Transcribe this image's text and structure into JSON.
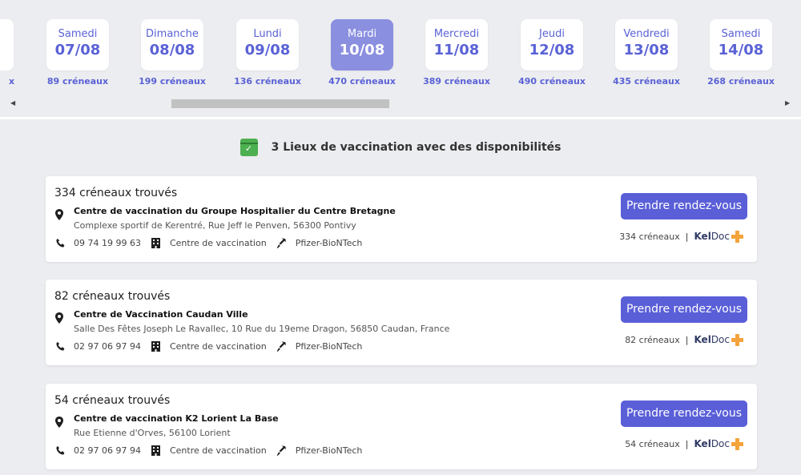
{
  "days": [
    {
      "name": "Samedi",
      "date": "07/08",
      "slots": "89 créneaux",
      "selected": false
    },
    {
      "name": "Dimanche",
      "date": "08/08",
      "slots": "199 créneaux",
      "selected": false
    },
    {
      "name": "Lundi",
      "date": "09/08",
      "slots": "136 créneaux",
      "selected": false
    },
    {
      "name": "Mardi",
      "date": "10/08",
      "slots": "470 créneaux",
      "selected": true
    },
    {
      "name": "Mercredi",
      "date": "11/08",
      "slots": "389 créneaux",
      "selected": false
    },
    {
      "name": "Jeudi",
      "date": "12/08",
      "slots": "490 créneaux",
      "selected": false
    },
    {
      "name": "Vendredi",
      "date": "13/08",
      "slots": "435 créneaux",
      "selected": false
    },
    {
      "name": "Samedi",
      "date": "14/08",
      "slots": "268 créneaux",
      "selected": false
    }
  ],
  "partial_day_slots": "x",
  "heading": "3 Lieux de vaccination avec des disponibilités",
  "centers": [
    {
      "title": "334 créneaux trouvés",
      "name": "Centre de vaccination du Groupe Hospitalier du Centre Bretagne",
      "address": "Complexe sportif de Kerentré, Rue Jeff le Penven, 56300 Pontivy",
      "phone": "09 74 19 99 63",
      "type": "Centre de vaccination",
      "vaccine": "Pfizer-BioNTech",
      "button": "Prendre rendez-vous",
      "slots": "334 créneaux"
    },
    {
      "title": "82 créneaux trouvés",
      "name": "Centre de Vaccination Caudan Ville",
      "address": "Salle Des Fêtes Joseph Le Ravallec, 10 Rue du 19eme Dragon, 56850 Caudan, France",
      "phone": "02 97 06 97 94",
      "type": "Centre de vaccination",
      "vaccine": "Pfizer-BioNTech",
      "button": "Prendre rendez-vous",
      "slots": "82 créneaux"
    },
    {
      "title": "54 créneaux trouvés",
      "name": "Centre de vaccination K2 Lorient La Base",
      "address": "Rue Etienne d'Orves, 56100 Lorient",
      "phone": "02 97 06 97 94",
      "type": "Centre de vaccination",
      "vaccine": "Pfizer-BioNTech",
      "button": "Prendre rendez-vous",
      "slots": "54 créneaux"
    }
  ],
  "platform": {
    "kel": "Kel",
    "doc": "Doc",
    "separator": "|"
  },
  "colors": {
    "accent": "#5a5fd8",
    "selected_day": "#8a8fe0",
    "kel_orange": "#f5a33b",
    "calendar_green": "#4caf50"
  },
  "icons": [
    "calendar-check-icon",
    "map-pin-icon",
    "phone-icon",
    "building-icon",
    "syringe-icon",
    "kel-plus-icon",
    "chevron-left-icon",
    "chevron-right-icon"
  ]
}
